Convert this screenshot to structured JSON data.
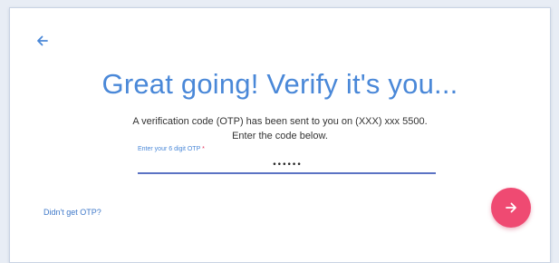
{
  "header": {
    "title": "Great going! Verify it's you..."
  },
  "message": {
    "line1": "A verification code (OTP) has been sent to you on (XXX) xxx 5500.",
    "line2": "Enter the code below."
  },
  "otp_field": {
    "label": "Enter your 6 digit OTP",
    "required_marker": "*",
    "value": "••••••"
  },
  "actions": {
    "resend_label": "Didn't get OTP?",
    "back_icon": "arrow-left-icon",
    "next_icon": "arrow-right-icon"
  },
  "colors": {
    "accent_blue": "#4a88d8",
    "button_pink": "#ef4a72",
    "input_underline": "#5b73c4"
  }
}
